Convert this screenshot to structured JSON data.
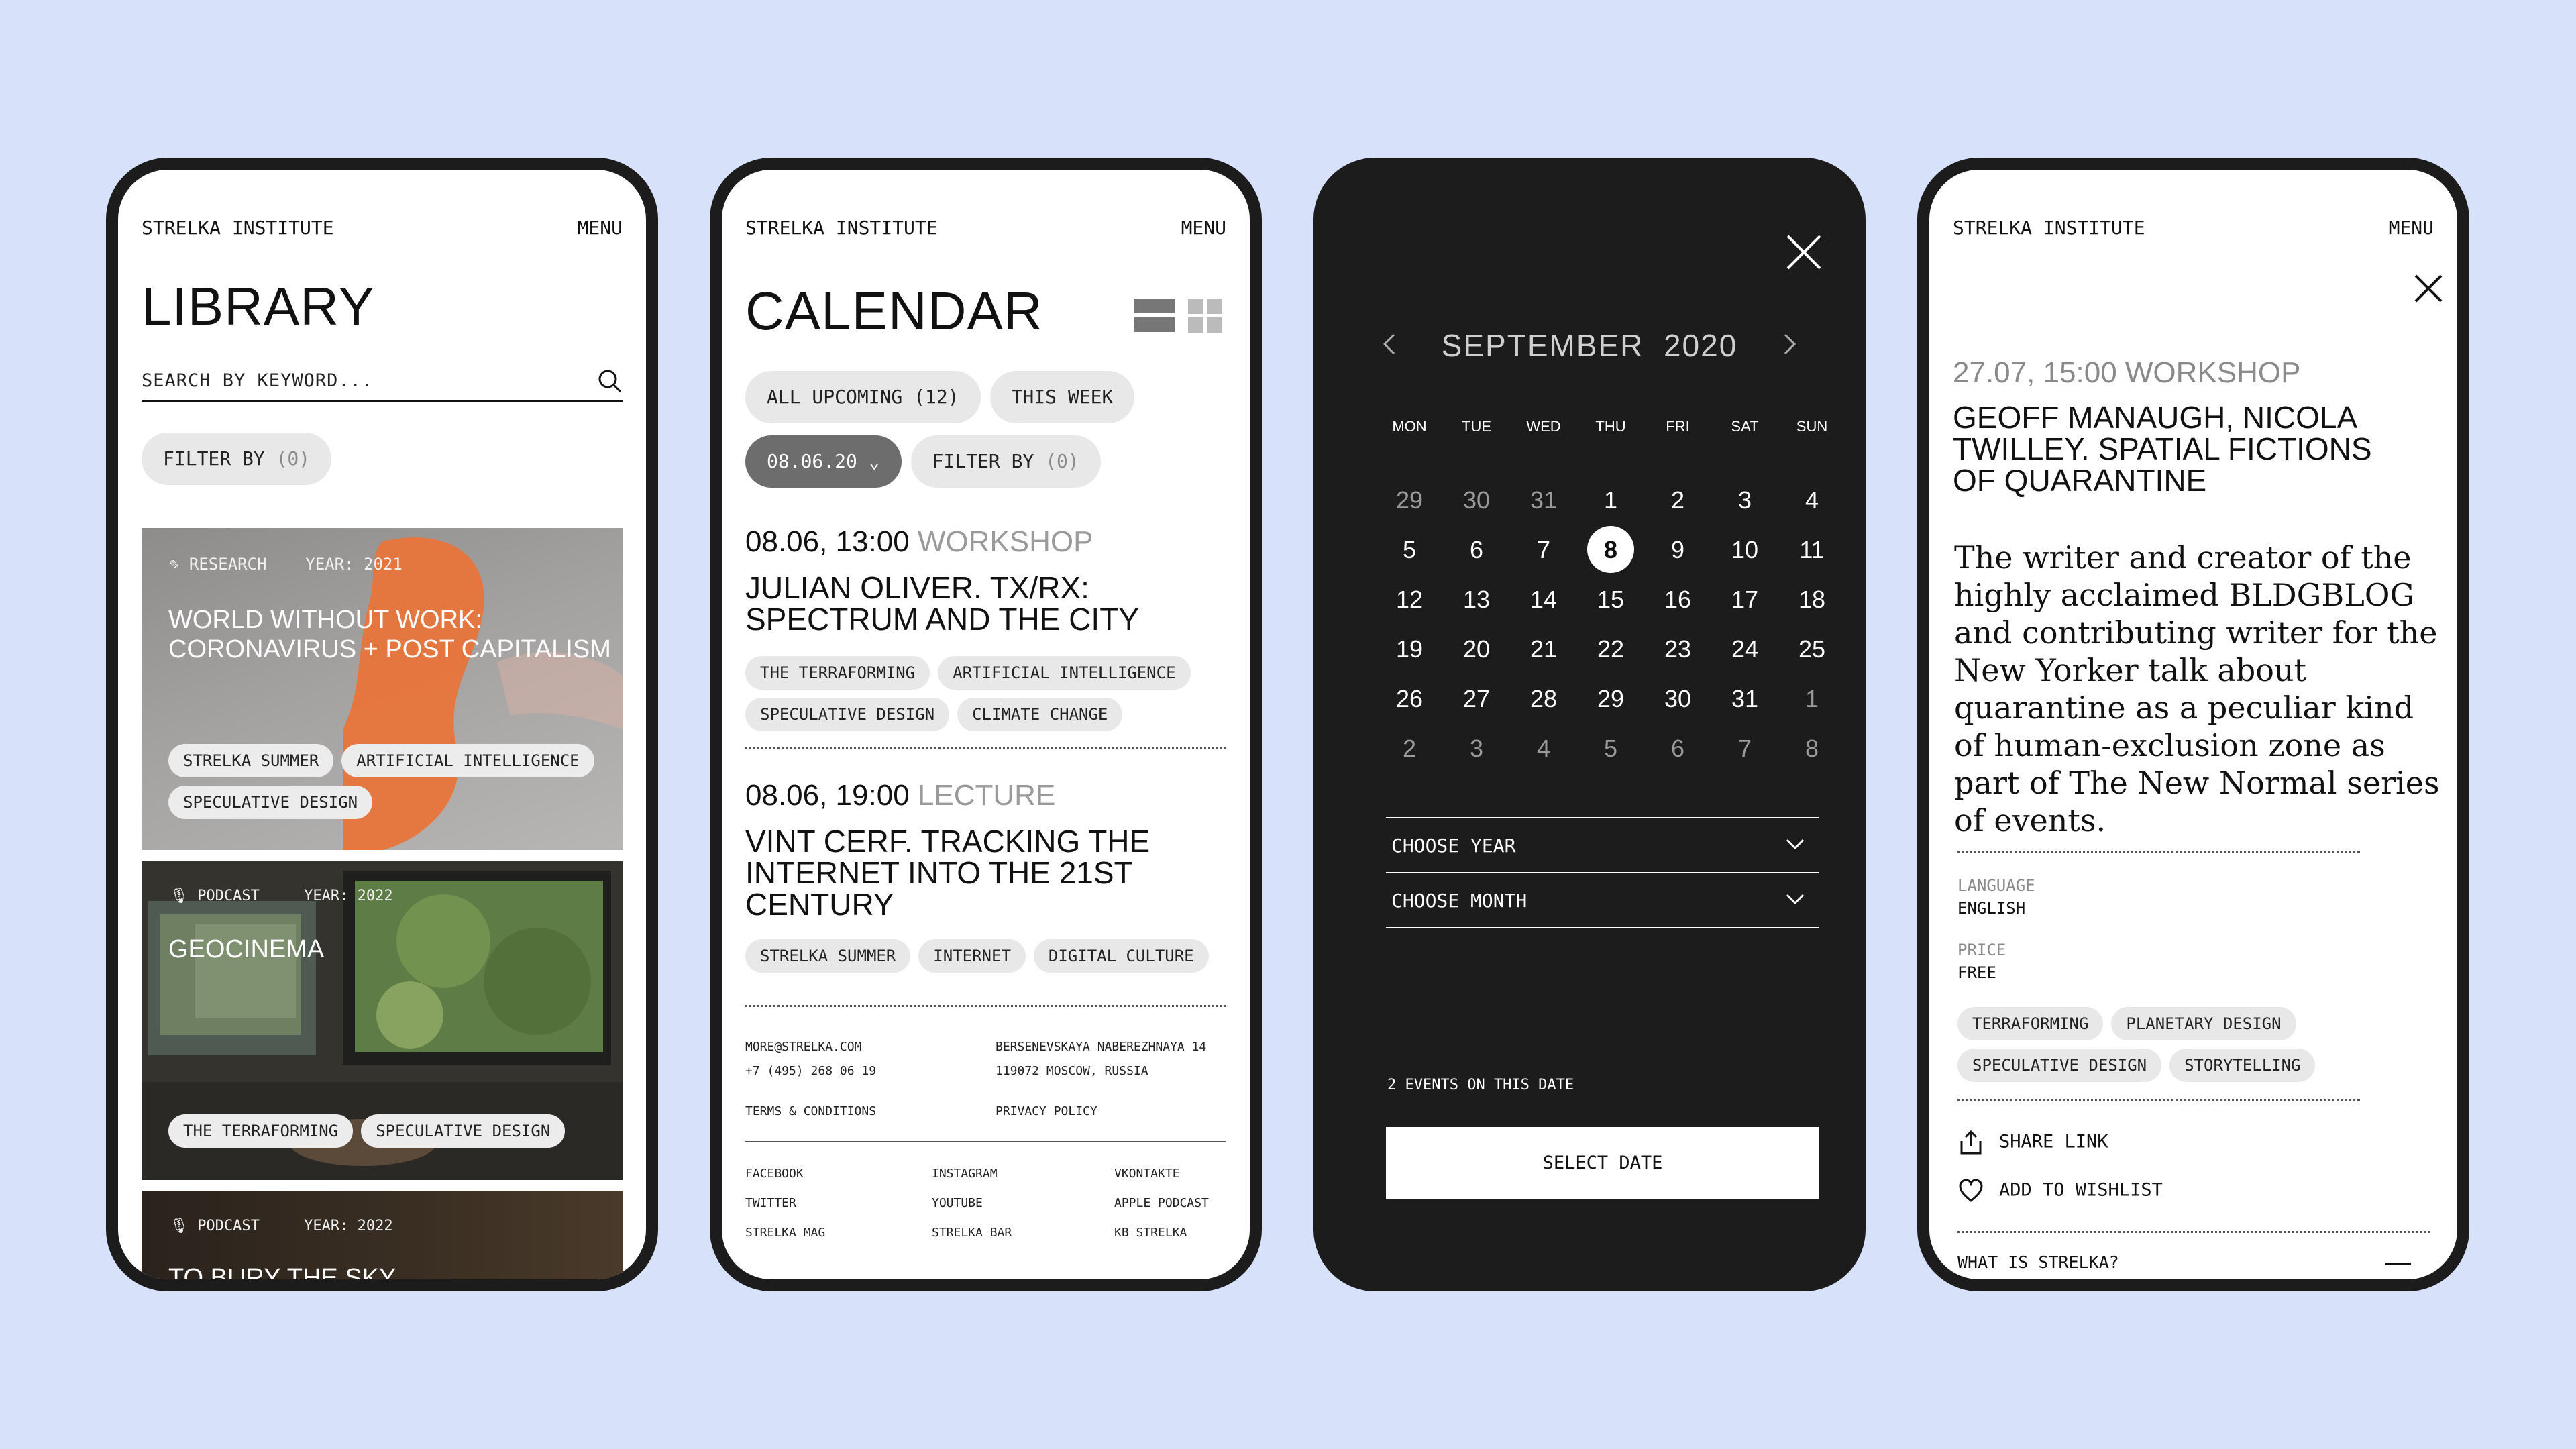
{
  "brand": "STRELKA INSTITUTE",
  "menu": "MENU",
  "library": {
    "title": "LIBRARY",
    "search_placeholder": "SEARCH BY KEYWORD...",
    "filter": "FILTER BY",
    "filter_count": "(0)",
    "cards": [
      {
        "type": "RESEARCH",
        "year_label": "YEAR:",
        "year": "2021",
        "title_line1": "WORLD WITHOUT WORK:",
        "title_line2": "CORONAVIRUS + POST CAPITALISM",
        "tags": [
          "STRELKA SUMMER",
          "ARTIFICIAL INTELLIGENCE",
          "SPECULATIVE DESIGN"
        ]
      },
      {
        "type": "PODCAST",
        "year_label": "YEAR:",
        "year": "2022",
        "title_line1": "GEOCINEMA",
        "tags": [
          "THE TERRAFORMING",
          "SPECULATIVE DESIGN"
        ]
      },
      {
        "type": "PODCAST",
        "year_label": "YEAR:",
        "year": "2022",
        "title_line1": "TO BURY THE SKY"
      }
    ]
  },
  "calendar": {
    "title": "CALENDAR",
    "tabs": [
      "ALL UPCOMING (12)",
      "THIS WEEK"
    ],
    "date_chip": "08.06.20",
    "filter": "FILTER BY",
    "filter_count": "(0)",
    "events": [
      {
        "when": "08.06, 13:00",
        "kind": "WORKSHOP",
        "title": "JULIAN OLIVER. TX/RX: SPECTRUM AND THE CITY",
        "tags": [
          "THE TERRAFORMING",
          "ARTIFICIAL INTELLIGENCE",
          "SPECULATIVE DESIGN",
          "CLIMATE CHANGE"
        ]
      },
      {
        "when": "08.06, 19:00",
        "kind": "LECTURE",
        "title": "VINT CERF. TRACKING THE INTERNET INTO THE 21ST CENTURY",
        "tags": [
          "STRELKA SUMMER",
          "INTERNET",
          "DIGITAL CULTURE"
        ]
      }
    ],
    "footer": {
      "email": "MORE@STRELKA.COM",
      "phone": "+7 (495) 268 06 19",
      "address1": "BERSENEVSKAYA NABEREZHNAYA 14",
      "address2": "119072 MOSCOW, RUSSIA",
      "terms": "TERMS & CONDITIONS",
      "privacy": "PRIVACY POLICY",
      "links": [
        "FACEBOOK",
        "INSTAGRAM",
        "VKONTAKTE",
        "TWITTER",
        "YOUTUBE",
        "APPLE PODCAST",
        "STRELKA MAG",
        "STRELKA BAR",
        "KB STRELKA"
      ]
    }
  },
  "datepicker": {
    "month": "SEPTEMBER",
    "year": "2020",
    "weekdays": [
      "MON",
      "TUE",
      "WED",
      "THU",
      "FRI",
      "SAT",
      "SUN"
    ],
    "weeks": [
      [
        "29",
        "30",
        "31",
        "1",
        "2",
        "3",
        "4"
      ],
      [
        "5",
        "6",
        "7",
        "8",
        "9",
        "10",
        "11"
      ],
      [
        "12",
        "13",
        "14",
        "15",
        "16",
        "17",
        "18"
      ],
      [
        "19",
        "20",
        "21",
        "22",
        "23",
        "24",
        "25"
      ],
      [
        "26",
        "27",
        "28",
        "29",
        "30",
        "31",
        "1"
      ],
      [
        "2",
        "3",
        "4",
        "5",
        "6",
        "7",
        "8"
      ]
    ],
    "selected_day": "8",
    "choose_year": "CHOOSE YEAR",
    "choose_month": "CHOOSE MONTH",
    "events_note": "2 EVENTS ON THIS DATE",
    "select_button": "SELECT DATE"
  },
  "event_detail": {
    "when": "27.07, 15:00 WORKSHOP",
    "title": "GEOFF MANAUGH, NICOLA TWILLEY. SPATIAL FICTIONS OF QUARANTINE",
    "description": "The writer and creator of the highly acclaimed BLDGBLOG and contributing writer for the New Yorker talk about quarantine as a peculiar kind of human-exclusion zone as part of The New Normal series of events.",
    "language_label": "LANGUAGE",
    "language": "ENGLISH",
    "price_label": "PRICE",
    "price": "FREE",
    "tags": [
      "TERRAFORMING",
      "PLANETARY DESIGN",
      "SPECULATIVE DESIGN",
      "STORYTELLING"
    ],
    "share": "SHARE LINK",
    "wishlist": "ADD TO WISHLIST",
    "accordion": "WHAT IS STRELKA?"
  }
}
